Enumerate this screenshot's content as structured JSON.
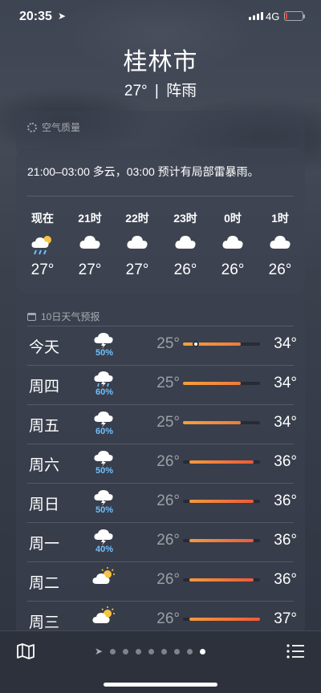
{
  "status_bar": {
    "time": "20:35",
    "network": "4G",
    "battery_level": 0.05,
    "battery_color": "#e4473c"
  },
  "location": {
    "city": "桂林市",
    "temperature": "27°",
    "separator": "|",
    "condition": "阵雨"
  },
  "air_quality": {
    "title": "空气质量",
    "icon": "dotted-circle-icon"
  },
  "hourly": {
    "summary": "21:00–03:00 多云，03:00 预计有局部雷暴雨。",
    "items": [
      {
        "label": "现在",
        "icon": "cloud-sun-rain-icon",
        "temp": "27°"
      },
      {
        "label": "21时",
        "icon": "cloud-icon",
        "temp": "27°"
      },
      {
        "label": "22时",
        "icon": "cloud-icon",
        "temp": "27°"
      },
      {
        "label": "23时",
        "icon": "cloud-icon",
        "temp": "26°"
      },
      {
        "label": "0时",
        "icon": "cloud-icon",
        "temp": "26°"
      },
      {
        "label": "1时",
        "icon": "cloud-icon",
        "temp": "26°"
      }
    ]
  },
  "forecast": {
    "title": "10日天气预报",
    "icon": "calendar-icon",
    "range_min": 25,
    "range_max": 37,
    "accent": "#6ec1ff",
    "days": [
      {
        "day": "今天",
        "icon": "cloud-bolt-icon",
        "pop": "50%",
        "low": "25°",
        "high": "34°",
        "lo": 25,
        "hi": 34,
        "current": 27
      },
      {
        "day": "周四",
        "icon": "cloud-bolt-rain-icon",
        "pop": "60%",
        "low": "25°",
        "high": "34°",
        "lo": 25,
        "hi": 34
      },
      {
        "day": "周五",
        "icon": "cloud-bolt-icon",
        "pop": "60%",
        "low": "25°",
        "high": "34°",
        "lo": 25,
        "hi": 34
      },
      {
        "day": "周六",
        "icon": "cloud-bolt-icon",
        "pop": "50%",
        "low": "26°",
        "high": "36°",
        "lo": 26,
        "hi": 36
      },
      {
        "day": "周日",
        "icon": "cloud-bolt-icon",
        "pop": "50%",
        "low": "26°",
        "high": "36°",
        "lo": 26,
        "hi": 36
      },
      {
        "day": "周一",
        "icon": "cloud-bolt-icon",
        "pop": "40%",
        "low": "26°",
        "high": "36°",
        "lo": 26,
        "hi": 36
      },
      {
        "day": "周二",
        "icon": "cloud-sun-icon",
        "pop": "",
        "low": "26°",
        "high": "36°",
        "lo": 26,
        "hi": 36
      },
      {
        "day": "周三",
        "icon": "cloud-sun-icon",
        "pop": "",
        "low": "26°",
        "high": "37°",
        "lo": 26,
        "hi": 37
      }
    ]
  },
  "bottom_bar": {
    "map_icon": "map-icon",
    "location_icon": "location-arrow-icon",
    "list_icon": "list-icon",
    "page_count": 8,
    "active_page": 8
  }
}
